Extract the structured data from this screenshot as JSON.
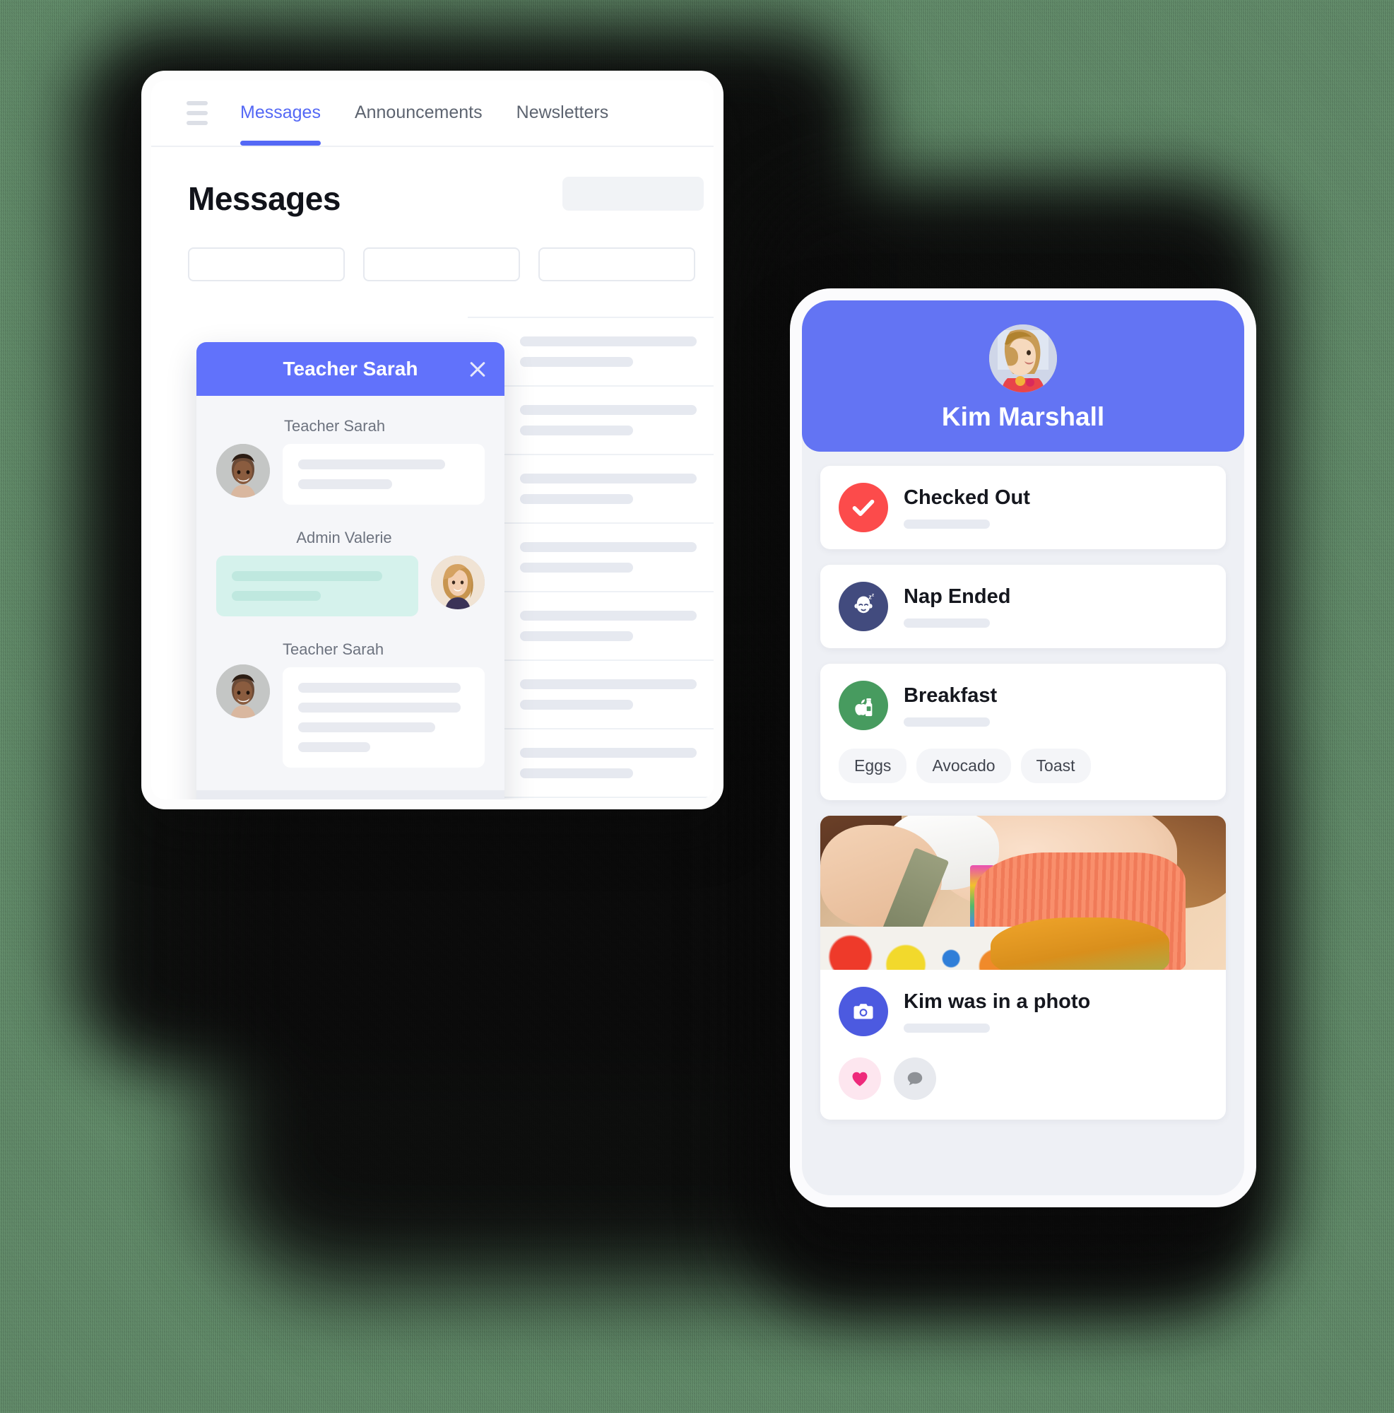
{
  "theme": {
    "page_background": "#587d5f",
    "accent_indigo": "#6172fb",
    "phone_header": "#6374f3",
    "status_red": "#fc4b4b",
    "status_navy": "#424b7e",
    "status_green": "#479b5f",
    "status_pink": "#ee2a7b",
    "bubble_teal": "#d5f2ec"
  },
  "tablet": {
    "nav": {
      "menu_icon": "hamburger-menu-icon",
      "tabs": [
        {
          "label": "Messages",
          "active": true
        },
        {
          "label": "Announcements",
          "active": false
        },
        {
          "label": "Newsletters",
          "active": false
        }
      ]
    },
    "page_title": "Messages",
    "filters": [
      {
        "name": "filter-one",
        "value": "",
        "placeholder": ""
      },
      {
        "name": "filter-two",
        "value": "",
        "placeholder": ""
      },
      {
        "name": "filter-three",
        "value": "",
        "placeholder": ""
      }
    ],
    "message_list": [
      {
        "unread": true
      },
      {
        "unread": true
      },
      {
        "unread": false
      },
      {
        "unread": false
      },
      {
        "unread": true
      },
      {
        "unread": false
      },
      {
        "unread": false
      }
    ]
  },
  "chat": {
    "title": "Teacher Sarah",
    "close_icon": "close-icon",
    "messages": [
      {
        "sender": "Teacher Sarah",
        "side": "left",
        "lines": 2,
        "avatar": "teacher-sarah-avatar"
      },
      {
        "sender": "Admin Valerie",
        "side": "right",
        "lines": 2,
        "avatar": "admin-valerie-avatar"
      },
      {
        "sender": "Teacher Sarah",
        "side": "left",
        "lines": 4,
        "avatar": "teacher-sarah-avatar"
      }
    ],
    "composer": {
      "value": "",
      "placeholder": "",
      "send_icon": "send-paper-plane-icon"
    }
  },
  "phone": {
    "child_name": "Kim Marshall",
    "avatar": "kim-marshall-avatar",
    "activities": [
      {
        "title": "Checked Out",
        "icon": "check-mark-icon",
        "color": "#fc4b4b",
        "chips": []
      },
      {
        "title": "Nap Ended",
        "icon": "sleeping-baby-icon",
        "color": "#424b7e",
        "chips": []
      },
      {
        "title": "Breakfast",
        "icon": "apple-and-milk-icon",
        "color": "#479b5f",
        "chips": [
          "Eggs",
          "Avocado",
          "Toast"
        ]
      }
    ],
    "photo_post": {
      "title": "Kim was in a photo",
      "icon": "camera-icon",
      "image_alt": "child painting with a brush",
      "like_icon": "heart-icon",
      "comment_icon": "comment-bubble-icon"
    }
  }
}
